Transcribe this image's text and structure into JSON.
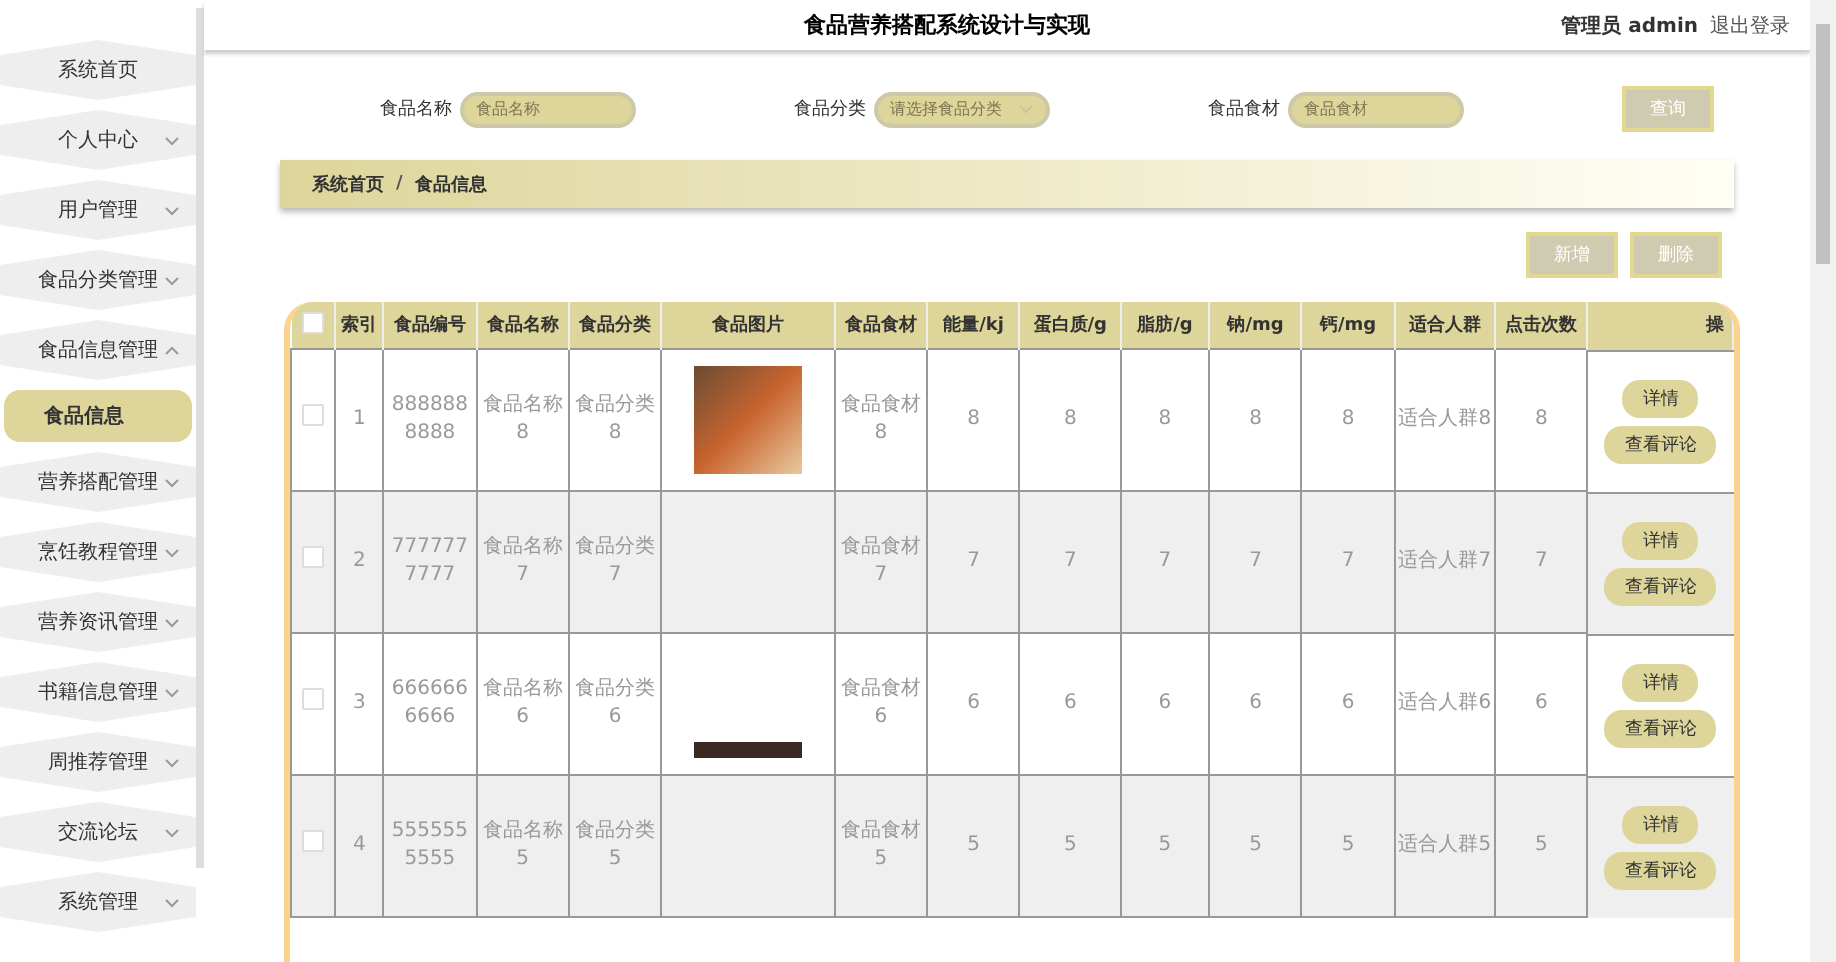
{
  "header": {
    "title": "食品营养搭配系统设计与实现",
    "user": "管理员 admin",
    "logout": "退出登录"
  },
  "sidebar": {
    "items": [
      {
        "label": "系统首页"
      },
      {
        "label": "个人中心",
        "expanded": false
      },
      {
        "label": "用户管理",
        "expanded": false
      },
      {
        "label": "食品分类管理",
        "expanded": false
      },
      {
        "label": "食品信息管理",
        "expanded": true,
        "children": [
          {
            "label": "食品信息",
            "selected": true
          }
        ]
      },
      {
        "label": "营养搭配管理",
        "expanded": false
      },
      {
        "label": "烹饪教程管理",
        "expanded": false
      },
      {
        "label": "营养资讯管理",
        "expanded": false
      },
      {
        "label": "书籍信息管理",
        "expanded": false
      },
      {
        "label": "周推荐管理",
        "expanded": false
      },
      {
        "label": "交流论坛",
        "expanded": false
      },
      {
        "label": "系统管理",
        "expanded": false
      }
    ]
  },
  "filters": [
    {
      "kind": "input",
      "label": "食品名称",
      "placeholder": "食品名称"
    },
    {
      "kind": "select",
      "label": "食品分类",
      "placeholder": "请选择食品分类"
    },
    {
      "kind": "input",
      "label": "食品食材",
      "placeholder": "食品食材"
    }
  ],
  "search_button": "查询",
  "breadcrumb": {
    "items": [
      "系统首页",
      "食品信息"
    ],
    "separator": "/"
  },
  "actions": [
    "新增",
    "删除"
  ],
  "table": {
    "header_checked": false,
    "columns": [
      "索引",
      "食品编号",
      "食品名称",
      "食品分类",
      "食品图片",
      "食品食材",
      "能量/kj",
      "蛋白质/g",
      "脂肪/g",
      "钠/mg",
      "钙/mg",
      "适合人群",
      "点击次数",
      "操"
    ],
    "rows": [
      {
        "checked": false,
        "cells": [
          "1",
          "8888888888",
          "食品名称8",
          "食品分类8",
          "",
          "食品食材8",
          "8",
          "8",
          "8",
          "8",
          "8",
          "适合人群8",
          "8"
        ],
        "buttons": [
          "详情",
          "查看评论"
        ]
      },
      {
        "checked": false,
        "cells": [
          "2",
          "7777777777",
          "食品名称7",
          "食品分类7",
          "",
          "食品食材7",
          "7",
          "7",
          "7",
          "7",
          "7",
          "适合人群7",
          "7"
        ],
        "buttons": [
          "详情",
          "查看评论"
        ]
      },
      {
        "checked": false,
        "cells": [
          "3",
          "6666666666",
          "食品名称6",
          "食品分类6",
          "",
          "食品食材6",
          "6",
          "6",
          "6",
          "6",
          "6",
          "适合人群6",
          "6"
        ],
        "buttons": [
          "详情",
          "查看评论"
        ]
      },
      {
        "checked": false,
        "cells": [
          "4",
          "5555555555",
          "食品名称5",
          "食品分类5",
          "",
          "食品食材5",
          "5",
          "5",
          "5",
          "5",
          "5",
          "适合人群5",
          "5"
        ],
        "buttons": [
          "详情",
          "查看评论"
        ]
      }
    ]
  }
}
